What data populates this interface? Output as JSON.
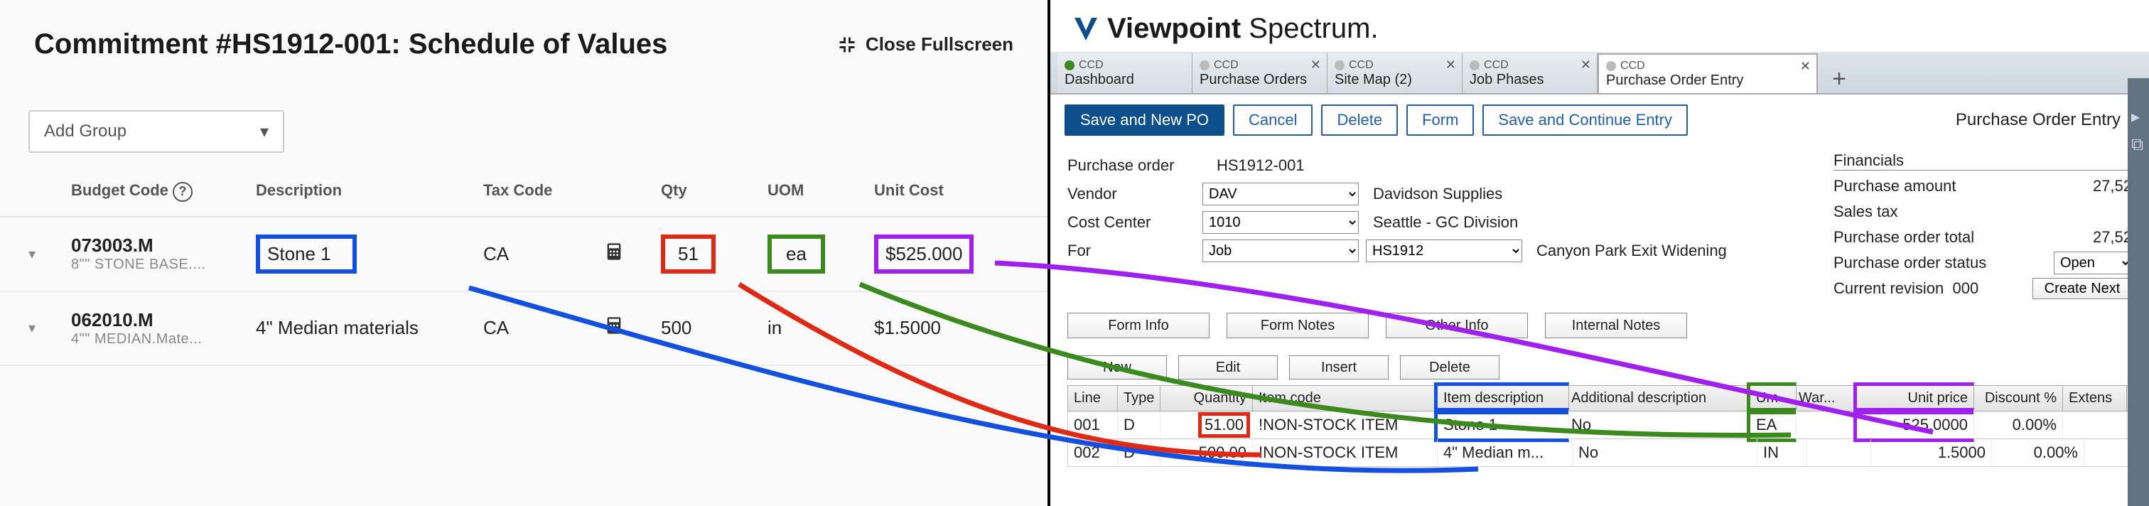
{
  "left": {
    "title": "Commitment #HS1912-001: Schedule of Values",
    "close_fullscreen": "Close Fullscreen",
    "add_group": "Add Group",
    "headers": {
      "budget": "Budget Code",
      "description": "Description",
      "tax": "Tax Code",
      "qty": "Qty",
      "uom": "UOM",
      "unit_cost": "Unit Cost"
    },
    "rows": [
      {
        "code": "073003.M",
        "code_sub": "8\"\" STONE BASE....",
        "desc": "Stone 1",
        "tax": "CA",
        "qty": "51",
        "uom": "ea",
        "cost": "$525.000"
      },
      {
        "code": "062010.M",
        "code_sub": "4\"\" MEDIAN.Mate...",
        "desc": "4\" Median materials",
        "tax": "CA",
        "qty": "500",
        "uom": "in",
        "cost": "$1.5000"
      }
    ]
  },
  "right": {
    "brand1": "Viewpoint",
    "brand2": "Spectrum",
    "tabs": [
      {
        "top": "CCD",
        "bot": "Dashboard",
        "icon": "#3a8a1e",
        "close": false
      },
      {
        "top": "CCD",
        "bot": "Purchase Orders",
        "icon": "#bbb",
        "close": true
      },
      {
        "top": "CCD",
        "bot": "Site Map (2)",
        "icon": "#bbb",
        "close": true
      },
      {
        "top": "CCD",
        "bot": "Job Phases",
        "icon": "#bbb",
        "close": true
      },
      {
        "top": "CCD",
        "bot": "Purchase Order Entry",
        "icon": "#bbb",
        "close": true,
        "active": true
      }
    ],
    "toolbar": {
      "save_new": "Save and New PO",
      "cancel": "Cancel",
      "delete": "Delete",
      "form": "Form",
      "save_cont": "Save and Continue Entry",
      "page_title": "Purchase Order Entry"
    },
    "form": {
      "po_label": "Purchase order",
      "po_value": "HS1912-001",
      "vendor_label": "Vendor",
      "vendor_value": "DAV",
      "vendor_name": "Davidson Supplies",
      "cc_label": "Cost Center",
      "cc_value": "1010",
      "cc_name": "Seattle - GC Division",
      "for_label": "For",
      "for_value": "Job",
      "for2_value": "HS1912",
      "for_name": "Canyon Park Exit Widening"
    },
    "financials": {
      "header": "Financials",
      "amount_l": "Purchase amount",
      "amount_v": "27,52",
      "tax_l": "Sales tax",
      "total_l": "Purchase order total",
      "total_v": "27,52",
      "status_l": "Purchase order status",
      "status_v": "Open",
      "rev_l": "Current revision",
      "rev_v": "000",
      "create_next": "Create Next"
    },
    "info_buttons": [
      "Form Info",
      "Form Notes",
      "Other Info",
      "Internal Notes"
    ],
    "grid_buttons": [
      "New",
      "Edit",
      "Insert",
      "Delete"
    ],
    "grid": {
      "headers": {
        "line": "Line",
        "type": "Type",
        "qty": "Quantity",
        "code": "Item code",
        "desc": "Item description",
        "add": "Additional description",
        "um": "Um",
        "war": "War...",
        "price": "Unit price",
        "disc": "Discount %",
        "ext": "Extens"
      },
      "rows": [
        {
          "line": "001",
          "type": "D",
          "qty": "51.00",
          "code": "!NON-STOCK ITEM",
          "desc": "Stone 1",
          "add": "No",
          "um": "EA",
          "war": "",
          "price": "525.0000",
          "disc": "0.00%"
        },
        {
          "line": "002",
          "type": "D",
          "qty": "500.00",
          "code": "!NON-STOCK ITEM",
          "desc": "4\" Median m...",
          "add": "No",
          "um": "IN",
          "war": "",
          "price": "1.5000",
          "disc": "0.00%"
        }
      ]
    }
  }
}
